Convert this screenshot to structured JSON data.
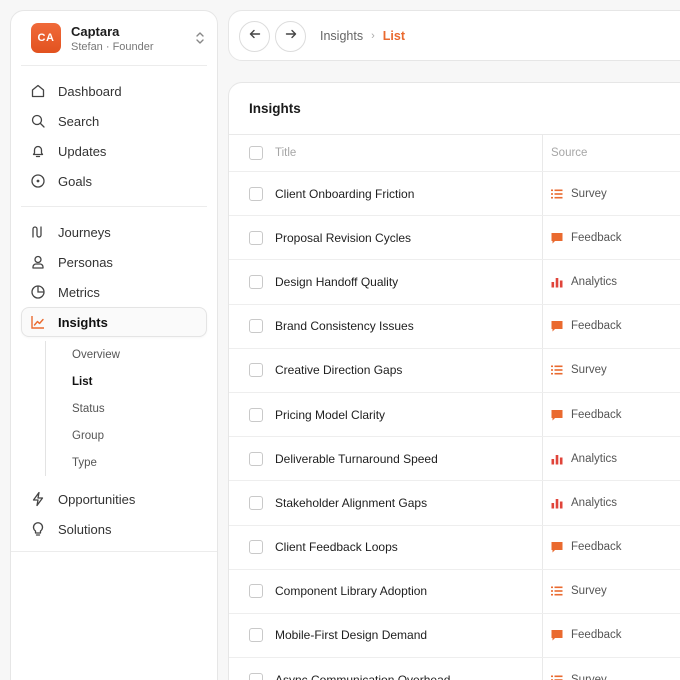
{
  "account": {
    "initials": "CA",
    "name": "Captara",
    "role": "Stefan · Founder"
  },
  "nav_primary": [
    {
      "label": "Dashboard",
      "icon": "home-icon"
    },
    {
      "label": "Search",
      "icon": "search-icon"
    },
    {
      "label": "Updates",
      "icon": "bell-icon"
    },
    {
      "label": "Goals",
      "icon": "target-icon"
    }
  ],
  "nav_secondary": [
    {
      "label": "Journeys",
      "icon": "route-icon"
    },
    {
      "label": "Personas",
      "icon": "user-icon"
    },
    {
      "label": "Metrics",
      "icon": "pie-chart-icon"
    },
    {
      "label": "Insights",
      "icon": "trend-icon",
      "active": true
    }
  ],
  "insights_sub": [
    "Overview",
    "List",
    "Status",
    "Group",
    "Type"
  ],
  "insights_sub_active": "List",
  "nav_tertiary": [
    {
      "label": "Opportunities",
      "icon": "bolt-icon"
    },
    {
      "label": "Solutions",
      "icon": "lightbulb-icon"
    }
  ],
  "breadcrumb": {
    "parent": "Insights",
    "separator": "›",
    "current": "List"
  },
  "panel": {
    "title": "Insights"
  },
  "table": {
    "columns": [
      "Title",
      "Source"
    ],
    "rows": [
      {
        "title": "Client Onboarding Friction",
        "source": "Survey"
      },
      {
        "title": "Proposal Revision Cycles",
        "source": "Feedback"
      },
      {
        "title": "Design Handoff Quality",
        "source": "Analytics"
      },
      {
        "title": "Brand Consistency Issues",
        "source": "Feedback"
      },
      {
        "title": "Creative Direction Gaps",
        "source": "Survey"
      },
      {
        "title": "Pricing Model Clarity",
        "source": "Feedback"
      },
      {
        "title": "Deliverable Turnaround Speed",
        "source": "Analytics"
      },
      {
        "title": "Stakeholder Alignment Gaps",
        "source": "Analytics"
      },
      {
        "title": "Client Feedback Loops",
        "source": "Feedback"
      },
      {
        "title": "Component Library Adoption",
        "source": "Survey"
      },
      {
        "title": "Mobile-First Design Demand",
        "source": "Feedback"
      },
      {
        "title": "Async Communication Overhead",
        "source": "Survey"
      }
    ]
  },
  "colors": {
    "accent": "#ea6a2f",
    "analytics": "#e0443a"
  }
}
